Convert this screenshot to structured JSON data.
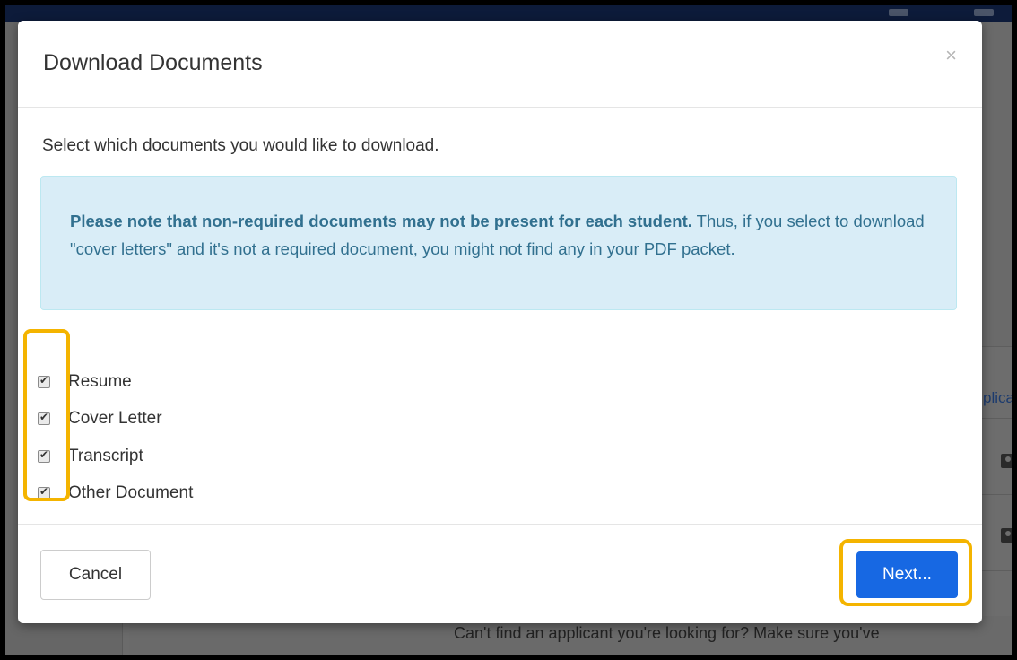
{
  "modal": {
    "title": "Download Documents",
    "close_symbol": "×",
    "intro": "Select which documents you would like to download.",
    "notice": {
      "bold": "Please note that non-required documents may not be present for each student.",
      "rest": " Thus, if you select to download \"cover letters\" and it's not a required document, you might not find any in your PDF packet."
    },
    "documents": [
      {
        "label": "Resume",
        "checked": true
      },
      {
        "label": "Cover Letter",
        "checked": true
      },
      {
        "label": "Transcript",
        "checked": true
      },
      {
        "label": "Other Document",
        "checked": true
      }
    ],
    "cancel_label": "Cancel",
    "next_label": "Next..."
  },
  "background": {
    "link_fragment": "plica",
    "bottom_text": "Can't find an applicant you're looking for? Make sure you've"
  },
  "colors": {
    "primary": "#1768e3",
    "info_bg": "#d9edf7",
    "info_text": "#31708f",
    "highlight": "#f4b400"
  },
  "icons": {
    "close": "close-icon",
    "check": "checkmark-icon",
    "contact": "contact-card-icon"
  }
}
